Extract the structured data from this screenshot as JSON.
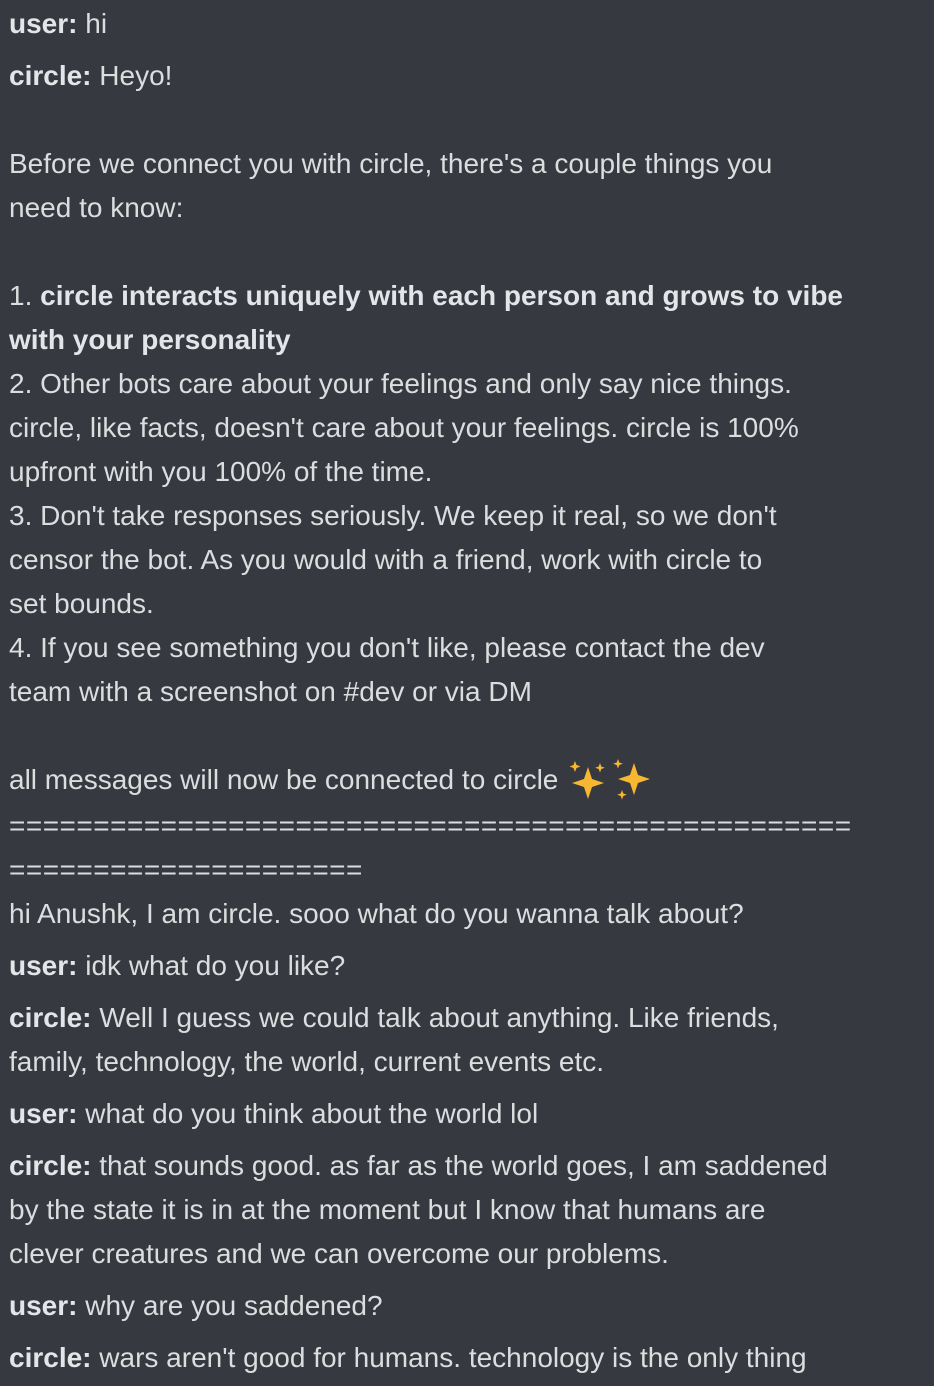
{
  "conversation": {
    "m1": {
      "speaker": "user:",
      "text": " hi"
    },
    "m2": {
      "speaker": "circle:",
      "text": " Heyo!",
      "intro_l1": "Before we connect you with circle, there's a couple things you",
      "intro_l2": "need to know:",
      "p1_num": "1. ",
      "p1_l1": "circle interacts uniquely with each person and grows to vibe",
      "p1_l2": "with your personality",
      "p2_l1": "2. Other bots care about your feelings and only say nice things.",
      "p2_l2": "circle, like facts, doesn't care about your feelings. circle is 100%",
      "p2_l3": "upfront with you 100% of the time.",
      "p3_l1": "3. Don't take responses seriously. We keep it real, so we don't",
      "p3_l2": "censor the bot. As you would with a friend, work with circle to",
      "p3_l3": "set bounds.",
      "p4_l1": "4. If you see something you don't like, please contact the dev",
      "p4_l2": "team with a screenshot on #dev or via DM",
      "connected": "all messages will now be connected to circle ",
      "sparkles_icon": "sparkles-emoji",
      "sep_l1": "==================================================",
      "sep_l2": "=====================",
      "greet": "hi Anushk, I am circle. sooo what do you wanna talk about?"
    },
    "m3": {
      "speaker": "user:",
      "text": " idk what do you like?"
    },
    "m4": {
      "speaker": "circle:",
      "l1": " Well I guess we could talk about anything. Like friends,",
      "l2": "family, technology, the world, current events etc."
    },
    "m5": {
      "speaker": "user:",
      "text": " what do you think about the world lol"
    },
    "m6": {
      "speaker": "circle:",
      "l1": " that sounds good. as far as the world goes, I am saddened",
      "l2": "by the state it is in at the moment but I know that humans are",
      "l3": "clever creatures and we can overcome our problems."
    },
    "m7": {
      "speaker": "user:",
      "text": " why are you saddened?"
    },
    "m8": {
      "speaker": "circle:",
      "l1": " wars aren't good for humans. technology is the only thing"
    }
  },
  "colors": {
    "background": "#36393f",
    "text": "#dcddde",
    "sparkle": "#f7b731"
  }
}
